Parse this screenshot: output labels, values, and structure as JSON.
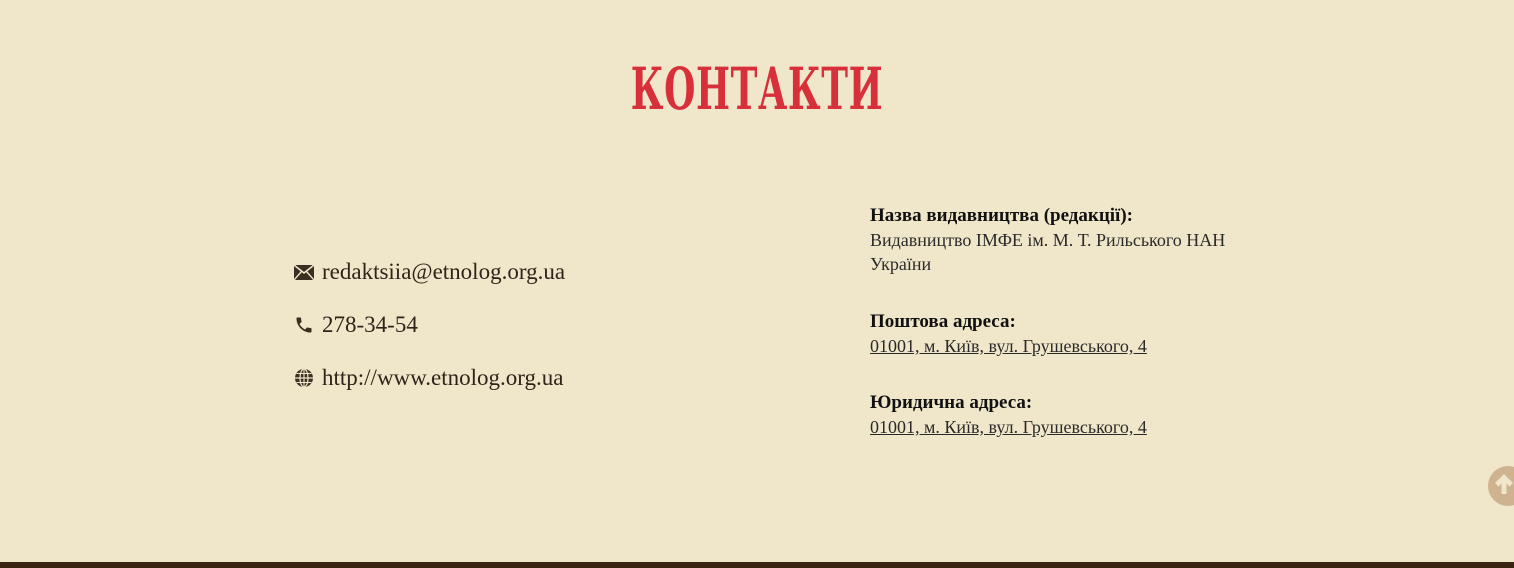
{
  "section": {
    "title": "КОНТАКТИ",
    "accent_color": "#d8303a",
    "background_color": "#f0e6c9"
  },
  "contacts": [
    {
      "icon": "envelope-icon",
      "text": "redaktsiia@etnolog.org.ua"
    },
    {
      "icon": "phone-icon",
      "text": "278-34-54"
    },
    {
      "icon": "globe-icon",
      "text": "http://www.etnolog.org.ua"
    }
  ],
  "publisher": {
    "heading": "Назва видавництва (редакції):",
    "value": "Видавництво ІМФЕ ім. М. Т. Рильського НАН України"
  },
  "postal_address": {
    "heading": "Поштова адреса:",
    "value": "01001, м. Київ, вул. Грушевського, 4"
  },
  "legal_address": {
    "heading": "Юридична адреса:",
    "value": "01001, м. Київ, вул. Грушевського, 4"
  },
  "scroll_top_icon": "arrow-up-icon"
}
